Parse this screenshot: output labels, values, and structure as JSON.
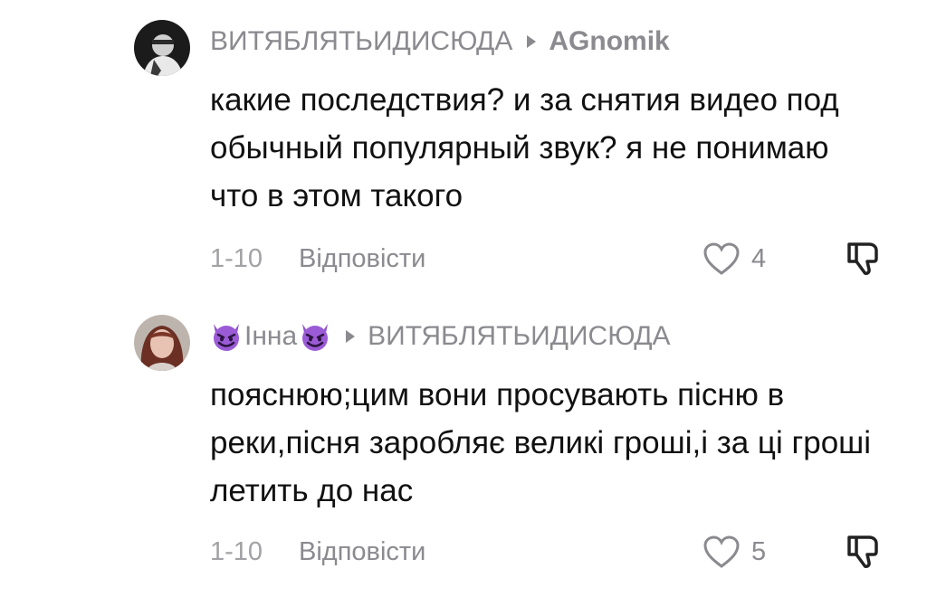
{
  "comments": [
    {
      "username": "ВИТЯБЛЯТЬИДИСЮДА",
      "reply_to": "AGnomik",
      "text": "какие последствия? и за снятия видео под обычный популярный звук? я не понимаю что в этом такого",
      "date": "1-10",
      "reply_label": "Відповісти",
      "likes": "4"
    },
    {
      "username": "Інна",
      "reply_to": "ВИТЯБЛЯТЬИДИСЮДА",
      "text": "пояснюю;цим вони просувають пісню в реки,пісня заробляє великі гроші,і за ці гроші летить до нас",
      "date": "1-10",
      "reply_label": "Відповісти",
      "likes": "5"
    }
  ],
  "icons": {
    "arrow": "reply-arrow-icon",
    "like": "heart-outline-icon",
    "dislike": "thumbs-down-icon",
    "emoji": "smiling-devil-emoji"
  },
  "colors": {
    "secondary_text": "#8a8a8f",
    "primary_text": "#111111",
    "emoji_purple": "#8e4fcf"
  }
}
